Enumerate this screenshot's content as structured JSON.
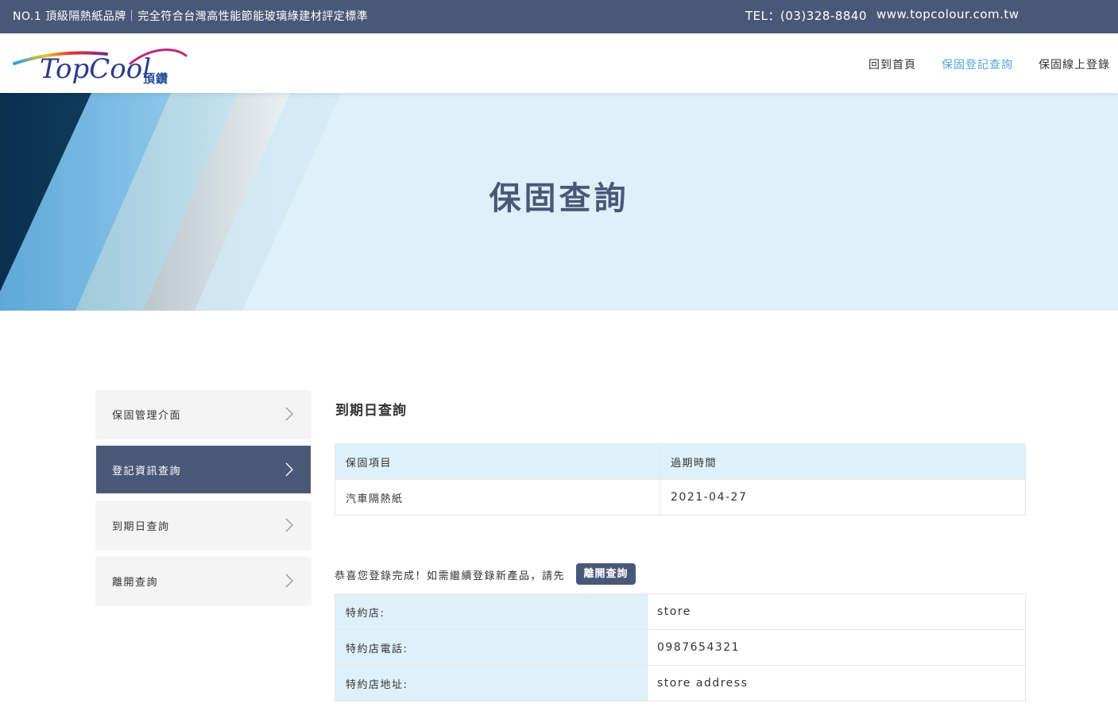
{
  "topbar": {
    "slogan": "NO.1 頂級隔熱紙品牌｜完全符合台灣高性能節能玻璃綠建材評定標準",
    "tel": "TEL：(03)328-8840",
    "website": "www.topcolour.com.tw"
  },
  "header": {
    "logo_text": "TopCool",
    "logo_cn": "頂鑽",
    "nav": [
      {
        "label": "回到首頁",
        "active": false
      },
      {
        "label": "保固登記查詢",
        "active": true
      },
      {
        "label": "保固線上登錄",
        "active": false
      }
    ]
  },
  "banner": {
    "title": "保固查詢"
  },
  "sidebar": {
    "items": [
      {
        "label": "保固管理介面",
        "active": false
      },
      {
        "label": "登記資訊查詢",
        "active": true
      },
      {
        "label": "到期日查詢",
        "active": false
      },
      {
        "label": "離開查詢",
        "active": false
      }
    ]
  },
  "main": {
    "title": "到期日查詢",
    "expiry_table": {
      "headers": [
        "保固項目",
        "過期時間"
      ],
      "rows": [
        [
          "汽車隔熱紙",
          "2021-04-27"
        ]
      ]
    },
    "notice": "恭喜您登錄完成！如需繼續登錄新產品，請先",
    "leave_button": "離開查詢",
    "store_table": [
      {
        "label": "特約店:",
        "value": "store"
      },
      {
        "label": "特約店電話:",
        "value": "0987654321"
      },
      {
        "label": "特約店地址:",
        "value": "store address"
      }
    ]
  },
  "colors": {
    "brand_navy": "#4a5878",
    "accent_blue": "#5aa3d6",
    "light_blue": "#def1fa"
  }
}
